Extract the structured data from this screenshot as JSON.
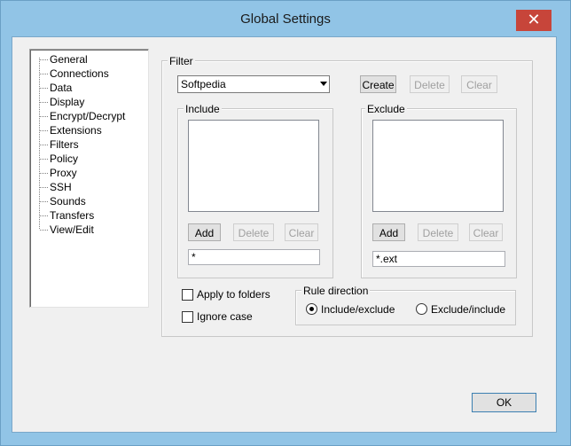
{
  "window": {
    "title": "Global Settings",
    "close_glyph": "✕"
  },
  "tree": {
    "items": [
      "General",
      "Connections",
      "Data",
      "Display",
      "Encrypt/Decrypt",
      "Extensions",
      "Filters",
      "Policy",
      "Proxy",
      "SSH",
      "Sounds",
      "Transfers",
      "View/Edit"
    ]
  },
  "filter": {
    "label": "Filter",
    "combo_value": "Softpedia",
    "create_label": "Create",
    "delete_label": "Delete",
    "clear_label": "Clear"
  },
  "include": {
    "label": "Include",
    "add_label": "Add",
    "delete_label": "Delete",
    "clear_label": "Clear",
    "input_value": "*"
  },
  "exclude": {
    "label": "Exclude",
    "add_label": "Add",
    "delete_label": "Delete",
    "clear_label": "Clear",
    "input_value": "*.ext"
  },
  "options": {
    "apply_to_folders": "Apply to folders",
    "ignore_case": "Ignore case"
  },
  "rule_direction": {
    "label": "Rule direction",
    "include_exclude": "Include/exclude",
    "exclude_include": "Exclude/include"
  },
  "footer": {
    "ok_label": "OK"
  }
}
